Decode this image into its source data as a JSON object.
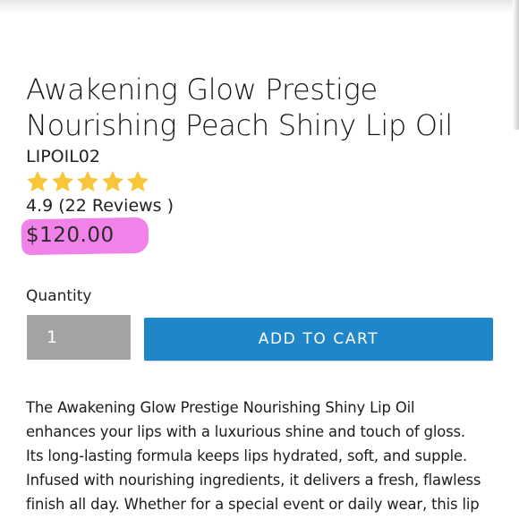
{
  "product": {
    "title": "Awakening Glow Prestige Nourishing Peach Shiny Lip Oil",
    "sku": "LIPOIL02",
    "rating": {
      "stars": 5,
      "star_color": "#f7c63a",
      "text": "4.9 (22 Reviews )"
    },
    "price": "$120.00",
    "price_highlight_color": "#f07be8"
  },
  "purchase": {
    "quantity_label": "Quantity",
    "quantity_value": "1",
    "add_to_cart_label": "ADD TO CART",
    "button_color": "#1f86c9"
  },
  "description": {
    "lines": [
      "The Awakening Glow Prestige Nourishing Shiny Lip Oil",
      "enhances your lips with a luxurious shine and touch of gloss.",
      "Its long-lasting formula keeps lips hydrated, soft, and supple.",
      "Infused with nourishing ingredients, it delivers a fresh, flawless",
      "finish all day. Whether for a special event or daily wear, this lip"
    ]
  }
}
